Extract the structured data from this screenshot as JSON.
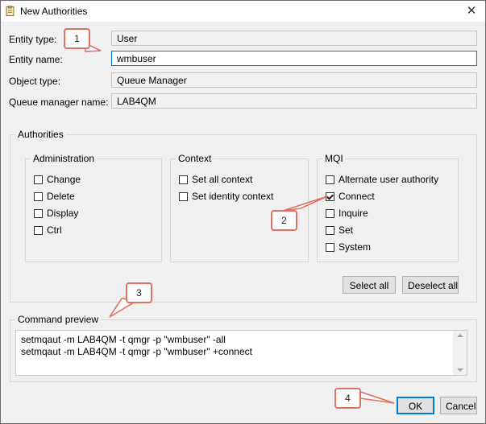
{
  "window": {
    "title": "New Authorities",
    "close_glyph": "✕",
    "app_icon": "clipboard-edit-icon"
  },
  "fields": {
    "entity_type": {
      "label": "Entity type:",
      "value": "User"
    },
    "entity_name": {
      "label": "Entity name:",
      "value": "wmbuser"
    },
    "object_type": {
      "label": "Object type:",
      "value": "Queue Manager"
    },
    "queue_manager_name": {
      "label": "Queue manager name:",
      "value": "LAB4QM"
    }
  },
  "authorities": {
    "title": "Authorities",
    "administration": {
      "title": "Administration",
      "items": [
        {
          "label": "Change",
          "checked": false
        },
        {
          "label": "Delete",
          "checked": false
        },
        {
          "label": "Display",
          "checked": false
        },
        {
          "label": "Ctrl",
          "checked": false
        }
      ]
    },
    "context": {
      "title": "Context",
      "items": [
        {
          "label": "Set all context",
          "checked": false
        },
        {
          "label": "Set identity context",
          "checked": false
        }
      ]
    },
    "mqi": {
      "title": "MQI",
      "items": [
        {
          "label": "Alternate user authority",
          "checked": false
        },
        {
          "label": "Connect",
          "checked": true
        },
        {
          "label": "Inquire",
          "checked": false
        },
        {
          "label": "Set",
          "checked": false
        },
        {
          "label": "System",
          "checked": false
        }
      ]
    },
    "select_all_label": "Select all",
    "deselect_all_label": "Deselect all"
  },
  "command_preview": {
    "title": "Command preview",
    "lines": [
      "setmqaut -m LAB4QM -t qmgr -p \"wmbuser\" -all",
      "setmqaut -m LAB4QM -t qmgr -p \"wmbuser\" +connect"
    ]
  },
  "buttons": {
    "ok": "OK",
    "cancel": "Cancel"
  },
  "callouts": [
    "1",
    "2",
    "3",
    "4"
  ],
  "colors": {
    "callout_border": "#e07060",
    "focus_blue": "#0078d7"
  }
}
